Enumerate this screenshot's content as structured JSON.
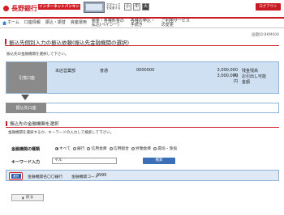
{
  "header": {
    "bank_name": "長野銀行",
    "service_badge": "インターネットバンキング",
    "font_size_label": "文字サイズを変更する",
    "font_sizes": [
      "小",
      "中",
      "大"
    ],
    "logout": "ログアウト"
  },
  "nav": {
    "items": [
      {
        "label": "ホーム"
      },
      {
        "label": "口座情報"
      },
      {
        "label": "振込・振替"
      },
      {
        "label": "資産運用"
      },
      {
        "label": "税金・各種料金の払込(ペイジー)"
      },
      {
        "label": "各種お申込・手続き"
      },
      {
        "label": "ご利用サービスの変更"
      }
    ]
  },
  "screen_id": "画面ID:BKM006",
  "page_title": "振込先個別入力の振込依頼(振込先金融機関の選択)",
  "guide": "振込先の金融機関を選択して下さい。",
  "from_account": {
    "label": "引落口座",
    "branch": "本店営業部",
    "type": "普通",
    "number": "0000000",
    "balance": "3,000,000円",
    "available": "3,000,000円",
    "balance_label": "残金残高",
    "available_label": "お引出し可能",
    "available_label2": "金額"
  },
  "to_account": {
    "label": "振込先口座"
  },
  "section": {
    "title": "振込先の金融機関を選択",
    "guide": "金融機関を選択するか、キーワードの入力して検索して下さい。"
  },
  "bank_type": {
    "label": "金融機関の種類",
    "options": [
      {
        "label": "すべて",
        "selected": true
      },
      {
        "label": "銀行",
        "selected": false
      },
      {
        "label": "信用金庫",
        "selected": false
      },
      {
        "label": "信用組合",
        "selected": false
      },
      {
        "label": "労働金庫",
        "selected": false
      },
      {
        "label": "農協・漁協",
        "selected": false
      }
    ]
  },
  "keyword": {
    "label": "キーワード入力",
    "value": "マル"
  },
  "search_button": "検索",
  "result": {
    "select_label": "選択",
    "bank_name_label": "金融機関名",
    "bank_name": "〇〇銀行",
    "bank_code_label": "金融機関コード",
    "bank_code": "9999"
  },
  "back_button": "戻る",
  "colors": {
    "brand_red": "#c81a22",
    "accent_blue": "#3d6fb6",
    "panel_blue": "#cfe0f2"
  }
}
